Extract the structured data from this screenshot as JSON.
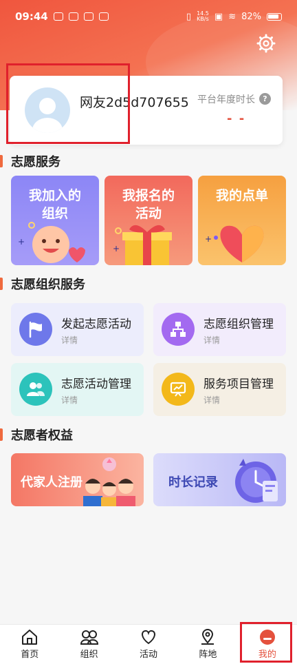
{
  "status_bar": {
    "time": "09:44",
    "net_speed_value": "14.5",
    "net_speed_unit": "KB/s",
    "battery": "82%"
  },
  "profile": {
    "username": "网友2d5d707655",
    "year_hours_label": "平台年度时长",
    "year_hours_value": "- -",
    "help_icon": "?"
  },
  "sections": {
    "volunteer_service": "志愿服务",
    "volunteer_org_service": "志愿组织服务",
    "volunteer_rights": "志愿者权益"
  },
  "service_cards": [
    {
      "label": "我加入的\n组织",
      "color": "#8d84f5"
    },
    {
      "label": "我报名的\n活动",
      "color": "#f2695c"
    },
    {
      "label": "我的点单",
      "color": "#f5a544"
    }
  ],
  "org_services": [
    {
      "title": "发起志愿活动",
      "sub": "详情",
      "icon": "flag-icon"
    },
    {
      "title": "志愿组织管理",
      "sub": "详情",
      "icon": "org-chart-icon"
    },
    {
      "title": "志愿活动管理",
      "sub": "详情",
      "icon": "people-icon"
    },
    {
      "title": "服务项目管理",
      "sub": "详情",
      "icon": "presentation-icon"
    }
  ],
  "benefits": [
    {
      "label": "代家人注册"
    },
    {
      "label": "时长记录"
    }
  ],
  "tabs": [
    {
      "label": "首页",
      "icon": "home-icon"
    },
    {
      "label": "组织",
      "icon": "group-icon"
    },
    {
      "label": "活动",
      "icon": "heart-icon"
    },
    {
      "label": "阵地",
      "icon": "location-icon"
    },
    {
      "label": "我的",
      "icon": "profile-icon",
      "active": true
    }
  ],
  "colors": {
    "accent": "#e4513d",
    "highlight": "#e0202c"
  }
}
